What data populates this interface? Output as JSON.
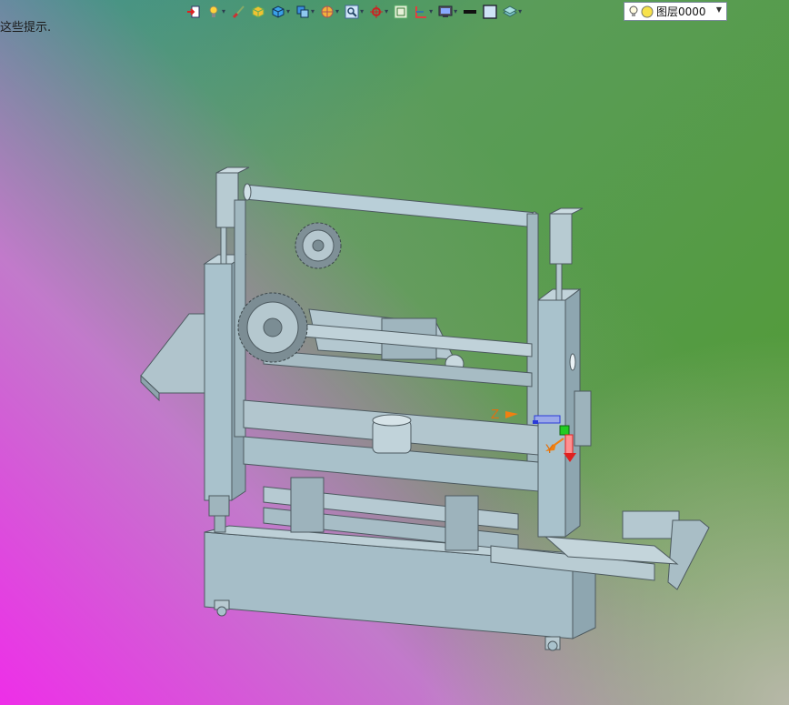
{
  "hint_text": "这些提示.",
  "toolbar": {
    "layer_combo": {
      "value": "图层0000"
    },
    "axis_labels": {
      "z": "Z",
      "y": "Y"
    }
  },
  "colors": {
    "model_fill": "#a9c2cc",
    "model_stroke": "#4d5a60",
    "axis_x": "#e02020",
    "axis_y": "#f08010",
    "axis_z": "#2a3ad8",
    "origin": "#22cc22"
  },
  "icons": [
    "import-icon",
    "light-icon",
    "brush-icon",
    "box-yellow-icon",
    "box-blue-icon",
    "boolean-icon",
    "sphere-icon",
    "zoom-icon",
    "pan-icon",
    "fit-icon",
    "section-icon",
    "display-icon",
    "line-style-icon",
    "color-square-icon",
    "layers-icon"
  ]
}
